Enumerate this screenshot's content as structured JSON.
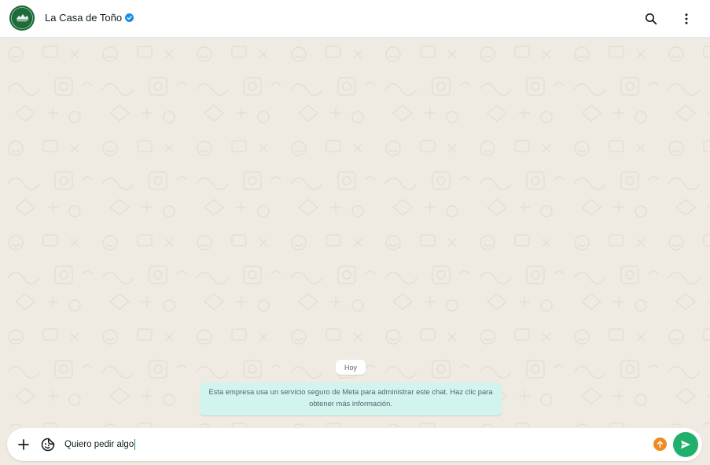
{
  "header": {
    "title": "La Casa de Toño",
    "avatar_icon": "restaurant-logo-icon",
    "verified_icon": "verified-badge-icon",
    "search_icon": "search-icon",
    "menu_icon": "more-vert-icon"
  },
  "chat": {
    "day_label": "Hoy",
    "system_message": "Esta empresa usa un servicio seguro de Meta para administrar este chat. Haz clic para obtener más información."
  },
  "composer": {
    "attach_icon": "plus-icon",
    "sticker_icon": "sticker-icon",
    "input_value": "Quiero pedir algo",
    "upload_icon": "arrow-up-icon",
    "send_icon": "send-icon"
  },
  "colors": {
    "brand_green": "#21b06b",
    "wallpaper": "#efeae2",
    "system_bubble": "#d1f4ef",
    "verified_blue": "#1d8fe0",
    "upload_orange": "#f08a24"
  }
}
